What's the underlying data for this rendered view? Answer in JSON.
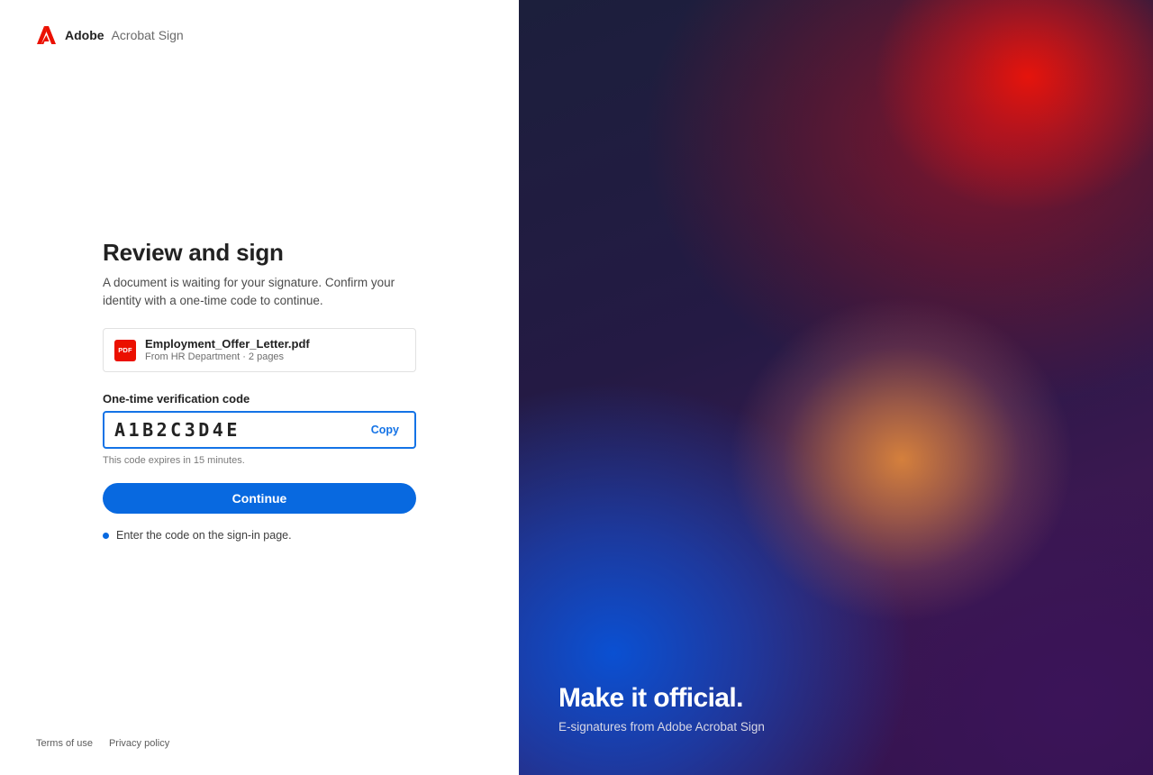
{
  "brand": {
    "name": "Adobe",
    "product": "Acrobat Sign",
    "logo_icon": "adobe-logo-icon",
    "accent": "#eb1000"
  },
  "main": {
    "title": "Review and sign",
    "subtitle": "A document is waiting for your signature. Confirm your identity with a one-time code to continue."
  },
  "document": {
    "badge": "PDF",
    "icon": "pdf-file-icon",
    "name": "Employment_Offer_Letter.pdf",
    "meta": "From HR Department · 2 pages"
  },
  "code": {
    "label": "One-time verification code",
    "value": "A1B2C3D4E",
    "copy_label": "Copy",
    "hint": "This code expires in 15 minutes.",
    "focus_color": "#1473e6"
  },
  "actions": {
    "continue_label": "Continue",
    "primary_color": "#0869e0"
  },
  "steps": [
    {
      "text": "Enter the code on the sign-in page."
    }
  ],
  "footer": {
    "links": [
      "Terms of use",
      "Privacy policy"
    ]
  },
  "promo": {
    "title": "Make it official.",
    "subtitle": "E-signatures from Adobe Acrobat Sign"
  }
}
